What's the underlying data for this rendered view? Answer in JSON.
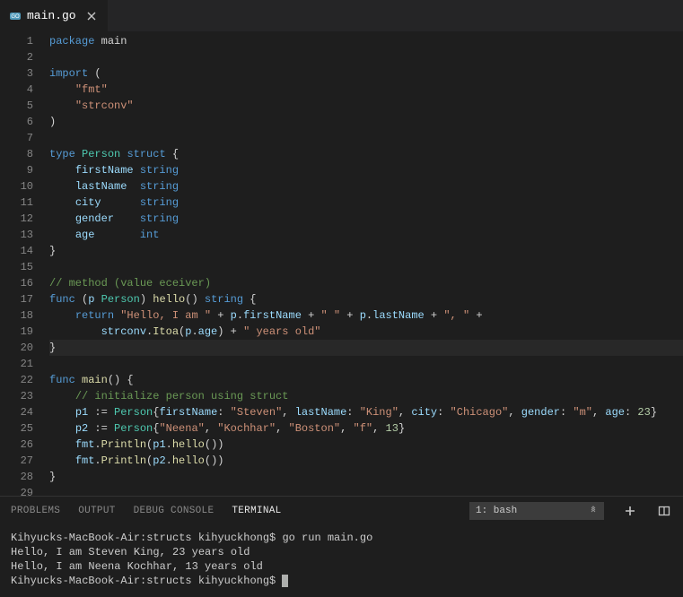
{
  "tab": {
    "label": "main.go"
  },
  "code": {
    "lines": [
      [
        {
          "c": "kw",
          "t": "package"
        },
        {
          "c": "pln",
          "t": " "
        },
        {
          "c": "pln",
          "t": "main"
        }
      ],
      [],
      [
        {
          "c": "kw",
          "t": "import"
        },
        {
          "c": "pln",
          "t": " ("
        }
      ],
      [
        {
          "c": "pln",
          "t": "    "
        },
        {
          "c": "str",
          "t": "\"fmt\""
        }
      ],
      [
        {
          "c": "pln",
          "t": "    "
        },
        {
          "c": "str",
          "t": "\"strconv\""
        }
      ],
      [
        {
          "c": "pln",
          "t": ")"
        }
      ],
      [],
      [
        {
          "c": "kw",
          "t": "type"
        },
        {
          "c": "pln",
          "t": " "
        },
        {
          "c": "typ",
          "t": "Person"
        },
        {
          "c": "pln",
          "t": " "
        },
        {
          "c": "kw",
          "t": "struct"
        },
        {
          "c": "pln",
          "t": " {"
        }
      ],
      [
        {
          "c": "pln",
          "t": "    "
        },
        {
          "c": "fld",
          "t": "firstName"
        },
        {
          "c": "pln",
          "t": " "
        },
        {
          "c": "ptyp",
          "t": "string"
        }
      ],
      [
        {
          "c": "pln",
          "t": "    "
        },
        {
          "c": "fld",
          "t": "lastName"
        },
        {
          "c": "pln",
          "t": "  "
        },
        {
          "c": "ptyp",
          "t": "string"
        }
      ],
      [
        {
          "c": "pln",
          "t": "    "
        },
        {
          "c": "fld",
          "t": "city"
        },
        {
          "c": "pln",
          "t": "      "
        },
        {
          "c": "ptyp",
          "t": "string"
        }
      ],
      [
        {
          "c": "pln",
          "t": "    "
        },
        {
          "c": "fld",
          "t": "gender"
        },
        {
          "c": "pln",
          "t": "    "
        },
        {
          "c": "ptyp",
          "t": "string"
        }
      ],
      [
        {
          "c": "pln",
          "t": "    "
        },
        {
          "c": "fld",
          "t": "age"
        },
        {
          "c": "pln",
          "t": "       "
        },
        {
          "c": "ptyp",
          "t": "int"
        }
      ],
      [
        {
          "c": "pln",
          "t": "}"
        }
      ],
      [],
      [
        {
          "c": "cmt",
          "t": "// method (value eceiver)"
        }
      ],
      [
        {
          "c": "kw",
          "t": "func"
        },
        {
          "c": "pln",
          "t": " ("
        },
        {
          "c": "fld",
          "t": "p"
        },
        {
          "c": "pln",
          "t": " "
        },
        {
          "c": "typ",
          "t": "Person"
        },
        {
          "c": "pln",
          "t": ") "
        },
        {
          "c": "fn",
          "t": "hello"
        },
        {
          "c": "pln",
          "t": "() "
        },
        {
          "c": "ptyp",
          "t": "string"
        },
        {
          "c": "pln",
          "t": " {"
        }
      ],
      [
        {
          "c": "pln",
          "t": "    "
        },
        {
          "c": "kw",
          "t": "return"
        },
        {
          "c": "pln",
          "t": " "
        },
        {
          "c": "str",
          "t": "\"Hello, I am \""
        },
        {
          "c": "pln",
          "t": " + "
        },
        {
          "c": "fld",
          "t": "p"
        },
        {
          "c": "pln",
          "t": "."
        },
        {
          "c": "fld",
          "t": "firstName"
        },
        {
          "c": "pln",
          "t": " + "
        },
        {
          "c": "str",
          "t": "\" \""
        },
        {
          "c": "pln",
          "t": " + "
        },
        {
          "c": "fld",
          "t": "p"
        },
        {
          "c": "pln",
          "t": "."
        },
        {
          "c": "fld",
          "t": "lastName"
        },
        {
          "c": "pln",
          "t": " + "
        },
        {
          "c": "str",
          "t": "\", \""
        },
        {
          "c": "pln",
          "t": " +"
        }
      ],
      [
        {
          "c": "pln",
          "t": "        "
        },
        {
          "c": "fld",
          "t": "strconv"
        },
        {
          "c": "pln",
          "t": "."
        },
        {
          "c": "fn",
          "t": "Itoa"
        },
        {
          "c": "pln",
          "t": "("
        },
        {
          "c": "fld",
          "t": "p"
        },
        {
          "c": "pln",
          "t": "."
        },
        {
          "c": "fld",
          "t": "age"
        },
        {
          "c": "pln",
          "t": ") + "
        },
        {
          "c": "str",
          "t": "\" years old\""
        }
      ],
      [
        {
          "c": "pln",
          "t": "}"
        }
      ],
      [],
      [
        {
          "c": "kw",
          "t": "func"
        },
        {
          "c": "pln",
          "t": " "
        },
        {
          "c": "fn",
          "t": "main"
        },
        {
          "c": "pln",
          "t": "() {"
        }
      ],
      [
        {
          "c": "pln",
          "t": "    "
        },
        {
          "c": "cmt",
          "t": "// initialize person using struct"
        }
      ],
      [
        {
          "c": "pln",
          "t": "    "
        },
        {
          "c": "fld",
          "t": "p1"
        },
        {
          "c": "pln",
          "t": " := "
        },
        {
          "c": "typ",
          "t": "Person"
        },
        {
          "c": "pln",
          "t": "{"
        },
        {
          "c": "fld",
          "t": "firstName"
        },
        {
          "c": "pln",
          "t": ": "
        },
        {
          "c": "str",
          "t": "\"Steven\""
        },
        {
          "c": "pln",
          "t": ", "
        },
        {
          "c": "fld",
          "t": "lastName"
        },
        {
          "c": "pln",
          "t": ": "
        },
        {
          "c": "str",
          "t": "\"King\""
        },
        {
          "c": "pln",
          "t": ", "
        },
        {
          "c": "fld",
          "t": "city"
        },
        {
          "c": "pln",
          "t": ": "
        },
        {
          "c": "str",
          "t": "\"Chicago\""
        },
        {
          "c": "pln",
          "t": ", "
        },
        {
          "c": "fld",
          "t": "gender"
        },
        {
          "c": "pln",
          "t": ": "
        },
        {
          "c": "str",
          "t": "\"m\""
        },
        {
          "c": "pln",
          "t": ", "
        },
        {
          "c": "fld",
          "t": "age"
        },
        {
          "c": "pln",
          "t": ": "
        },
        {
          "c": "num",
          "t": "23"
        },
        {
          "c": "pln",
          "t": "}"
        }
      ],
      [
        {
          "c": "pln",
          "t": "    "
        },
        {
          "c": "fld",
          "t": "p2"
        },
        {
          "c": "pln",
          "t": " := "
        },
        {
          "c": "typ",
          "t": "Person"
        },
        {
          "c": "pln",
          "t": "{"
        },
        {
          "c": "str",
          "t": "\"Neena\""
        },
        {
          "c": "pln",
          "t": ", "
        },
        {
          "c": "str",
          "t": "\"Kochhar\""
        },
        {
          "c": "pln",
          "t": ", "
        },
        {
          "c": "str",
          "t": "\"Boston\""
        },
        {
          "c": "pln",
          "t": ", "
        },
        {
          "c": "str",
          "t": "\"f\""
        },
        {
          "c": "pln",
          "t": ", "
        },
        {
          "c": "num",
          "t": "13"
        },
        {
          "c": "pln",
          "t": "}"
        }
      ],
      [
        {
          "c": "pln",
          "t": "    "
        },
        {
          "c": "fld",
          "t": "fmt"
        },
        {
          "c": "pln",
          "t": "."
        },
        {
          "c": "fn",
          "t": "Println"
        },
        {
          "c": "pln",
          "t": "("
        },
        {
          "c": "fld",
          "t": "p1"
        },
        {
          "c": "pln",
          "t": "."
        },
        {
          "c": "fn",
          "t": "hello"
        },
        {
          "c": "pln",
          "t": "())"
        }
      ],
      [
        {
          "c": "pln",
          "t": "    "
        },
        {
          "c": "fld",
          "t": "fmt"
        },
        {
          "c": "pln",
          "t": "."
        },
        {
          "c": "fn",
          "t": "Println"
        },
        {
          "c": "pln",
          "t": "("
        },
        {
          "c": "fld",
          "t": "p2"
        },
        {
          "c": "pln",
          "t": "."
        },
        {
          "c": "fn",
          "t": "hello"
        },
        {
          "c": "pln",
          "t": "())"
        }
      ],
      [
        {
          "c": "pln",
          "t": "}"
        }
      ],
      []
    ],
    "highlight_line": 20
  },
  "panel": {
    "tabs": {
      "problems": "PROBLEMS",
      "output": "OUTPUT",
      "debug": "DEBUG CONSOLE",
      "terminal": "TERMINAL"
    },
    "selector": "1: bash",
    "terminal_lines": [
      "Kihyucks-MacBook-Air:structs kihyuckhong$ go run main.go",
      "Hello, I am Steven King, 23 years old",
      "Hello, I am Neena Kochhar, 13 years old",
      "Kihyucks-MacBook-Air:structs kihyuckhong$ "
    ]
  }
}
